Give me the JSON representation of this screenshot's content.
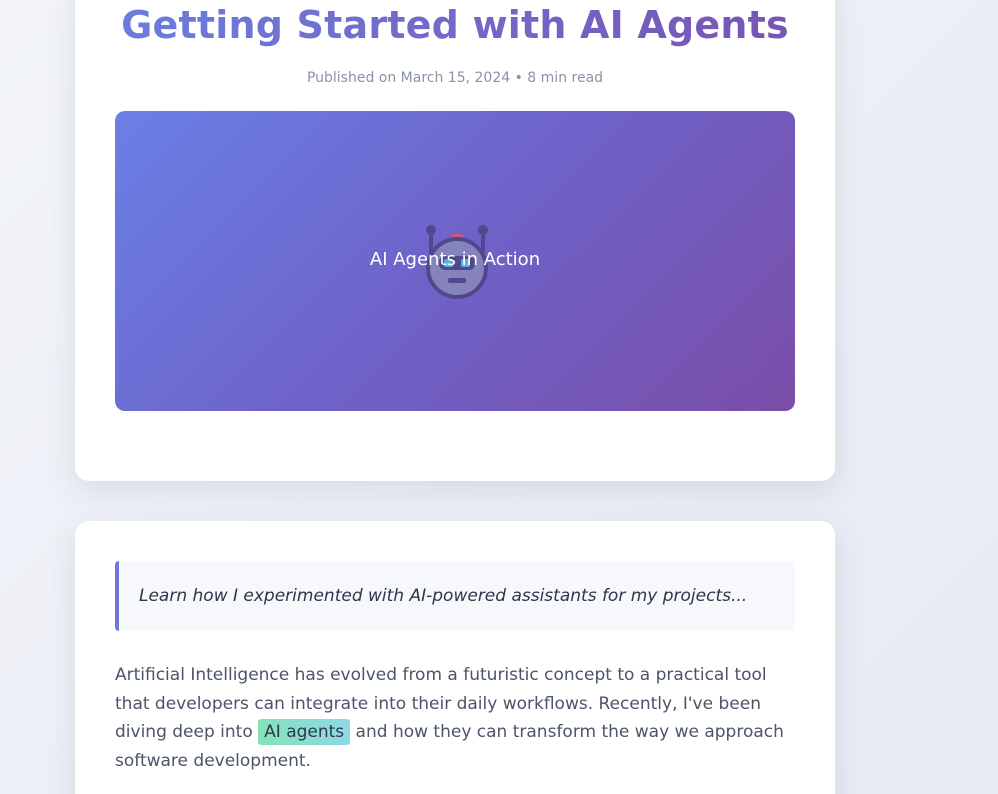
{
  "article": {
    "title": "Getting Started with AI Agents",
    "meta": "Published on March 15, 2024 • 8 min read",
    "hero": {
      "caption": "AI Agents in Action",
      "icon": "robot-icon",
      "gradient_start": "#6a80e6",
      "gradient_end": "#7a4ea8"
    },
    "quote": "Learn how I experimented with AI-powered assistants for my projects...",
    "paragraph": {
      "before": "Artificial Intelligence has evolved from a futuristic concept to a practical tool that developers can integrate into their daily workflows. Recently, I've been diving deep into ",
      "highlight": "AI agents",
      "after": " and how they can transform the way we approach software development."
    }
  },
  "colors": {
    "accent": "#6f78d8",
    "title_gradient_start": "#6b7fe0",
    "title_gradient_end": "#7a52b0",
    "highlight_start": "#84e2b8",
    "highlight_end": "#8ed9e8"
  }
}
